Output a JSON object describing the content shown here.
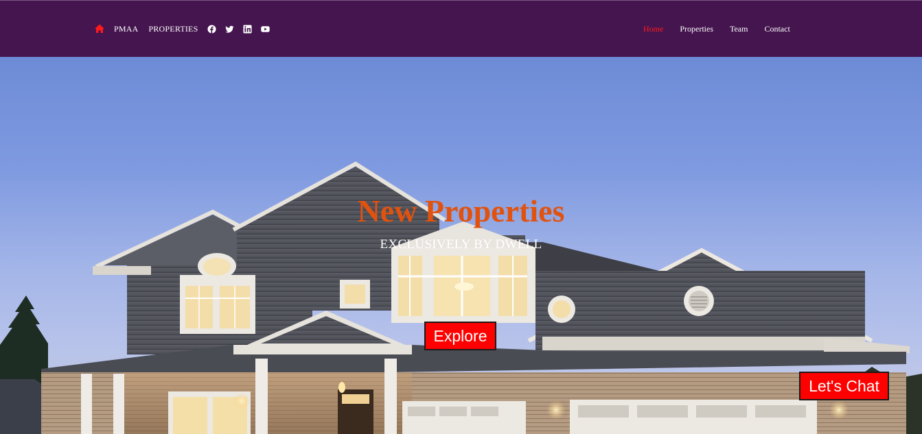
{
  "header": {
    "brand": [
      "PMAA",
      "PROPERTIES"
    ],
    "home_icon": "home-icon",
    "accent_color": "#ff0000",
    "background_color": "#45154f",
    "social_icons": [
      "facebook-icon",
      "twitter-icon",
      "linkedin-icon",
      "youtube-icon"
    ],
    "nav": [
      {
        "label": "Home",
        "active": true
      },
      {
        "label": "Properties",
        "active": false
      },
      {
        "label": "Team",
        "active": false
      },
      {
        "label": "Contact",
        "active": false
      }
    ]
  },
  "hero": {
    "title": "New Properties",
    "subtitle": "EXCLUSIVELY BY DWELL",
    "explore_label": "Explore",
    "title_color": "#e2520f"
  },
  "chat": {
    "label": "Let's Chat"
  }
}
